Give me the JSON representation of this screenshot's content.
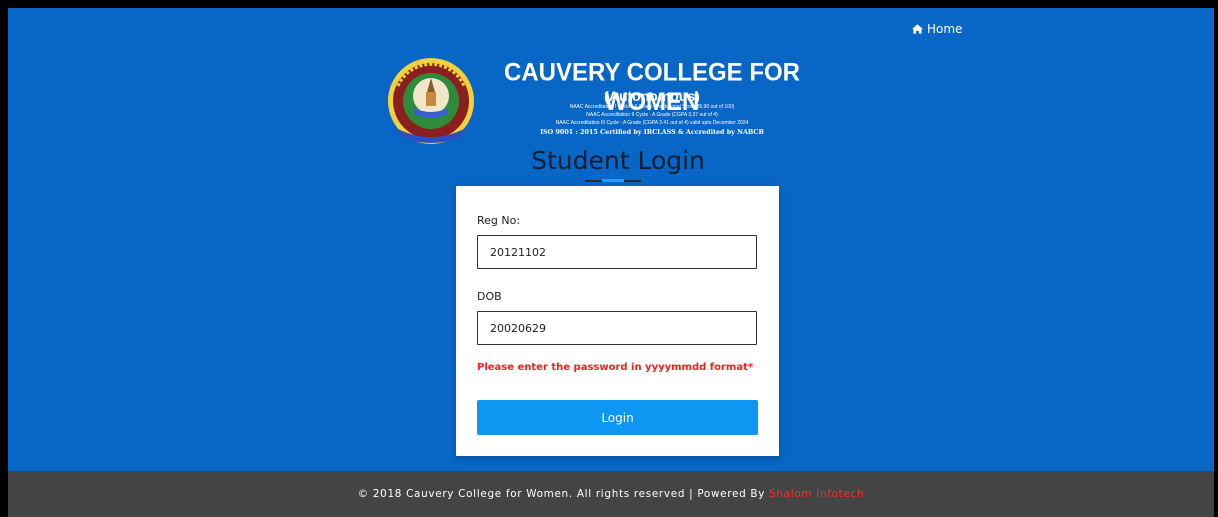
{
  "nav": {
    "home_label": "Home"
  },
  "header": {
    "college_name": "CAUVERY COLLEGE FOR WOMEN",
    "subtitle": "(Autonomous)",
    "accreditation_lines": [
      "NAAC Accreditation I Cycle : A Grade (Institutional Score 85.90 out of 100)",
      "NAAC Accreditation II Cycle : A Grade (CGPA 3.37 out of 4)",
      "NAAC Accreditation III Cycle : A Grade (CGPA 3.41 out of 4) valid upto December 2024"
    ],
    "iso_line": "ISO 9001 : 2015 Certified by IRCLASS & Accredited by NABCB"
  },
  "page_title": "Student Login",
  "form": {
    "reg_label": "Reg No:",
    "reg_value": "20121102",
    "dob_label": "DOB",
    "dob_value": "20020629",
    "hint": "Please enter the password in yyyymmdd format*",
    "submit_label": "Login"
  },
  "footer": {
    "text": "© 2018 Cauvery College for Women. All rights reserved | Powered By ",
    "brand": "Shalom Infotech"
  },
  "colors": {
    "background": "#0866c6",
    "button": "#0d96f2",
    "hint": "#ff1a1a",
    "footer": "#444444",
    "brand": "#ff2a2a"
  }
}
